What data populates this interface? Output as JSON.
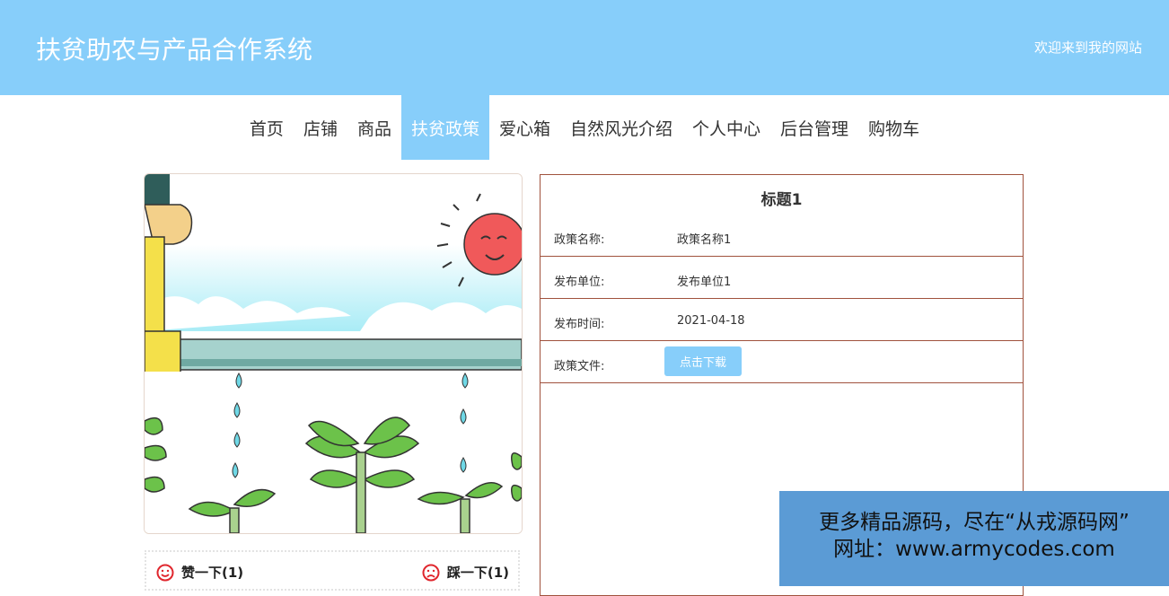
{
  "header": {
    "title": "扶贫助农与产品合作系统",
    "welcome": "欢迎来到我的网站",
    "background": "#87cefa"
  },
  "nav": {
    "items": [
      "首页",
      "店铺",
      "商品",
      "扶贫政策",
      "爱心箱",
      "自然风光介绍",
      "个人中心",
      "后台管理",
      "购物车"
    ],
    "active": "扶贫政策"
  },
  "votes": {
    "like": "赞一下(1)",
    "dislike": "踩一下(1)",
    "like_icon": "smile-icon",
    "dislike_icon": "frown-icon"
  },
  "detail": {
    "title": "标题1",
    "rows": [
      {
        "label": "政策名称:",
        "value": "政策名称1"
      },
      {
        "label": "发布单位:",
        "value": "发布单位1"
      },
      {
        "label": "发布时间:",
        "value": "2021-04-18"
      },
      {
        "label": "政策文件:",
        "button": "点击下载"
      }
    ]
  },
  "watermark": {
    "line1": "更多精品源码，尽在“从戎源码网”",
    "line2": "网址：www.armycodes.com"
  },
  "colors": {
    "accent": "#87cefa",
    "border": "#a0523d",
    "vote_icon": "#e0262d"
  }
}
